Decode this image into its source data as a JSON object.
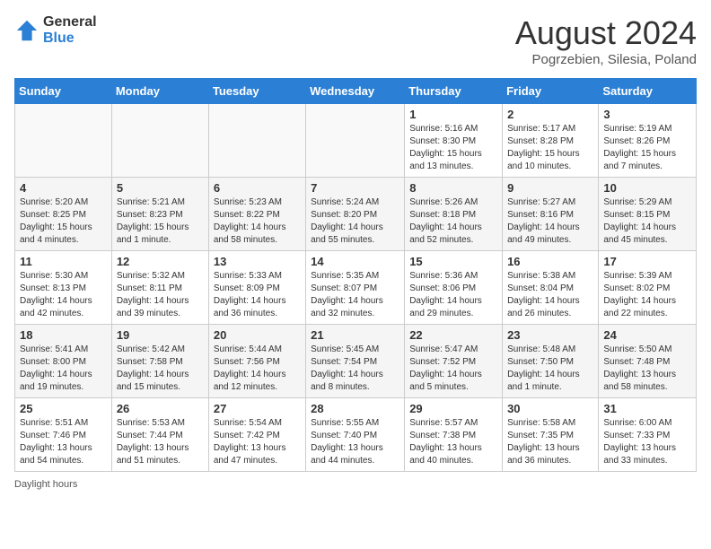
{
  "logo": {
    "general": "General",
    "blue": "Blue"
  },
  "title": "August 2024",
  "location": "Pogrzebien, Silesia, Poland",
  "days_header": [
    "Sunday",
    "Monday",
    "Tuesday",
    "Wednesday",
    "Thursday",
    "Friday",
    "Saturday"
  ],
  "weeks": [
    [
      {
        "num": "",
        "info": ""
      },
      {
        "num": "",
        "info": ""
      },
      {
        "num": "",
        "info": ""
      },
      {
        "num": "",
        "info": ""
      },
      {
        "num": "1",
        "info": "Sunrise: 5:16 AM\nSunset: 8:30 PM\nDaylight: 15 hours\nand 13 minutes."
      },
      {
        "num": "2",
        "info": "Sunrise: 5:17 AM\nSunset: 8:28 PM\nDaylight: 15 hours\nand 10 minutes."
      },
      {
        "num": "3",
        "info": "Sunrise: 5:19 AM\nSunset: 8:26 PM\nDaylight: 15 hours\nand 7 minutes."
      }
    ],
    [
      {
        "num": "4",
        "info": "Sunrise: 5:20 AM\nSunset: 8:25 PM\nDaylight: 15 hours\nand 4 minutes."
      },
      {
        "num": "5",
        "info": "Sunrise: 5:21 AM\nSunset: 8:23 PM\nDaylight: 15 hours\nand 1 minute."
      },
      {
        "num": "6",
        "info": "Sunrise: 5:23 AM\nSunset: 8:22 PM\nDaylight: 14 hours\nand 58 minutes."
      },
      {
        "num": "7",
        "info": "Sunrise: 5:24 AM\nSunset: 8:20 PM\nDaylight: 14 hours\nand 55 minutes."
      },
      {
        "num": "8",
        "info": "Sunrise: 5:26 AM\nSunset: 8:18 PM\nDaylight: 14 hours\nand 52 minutes."
      },
      {
        "num": "9",
        "info": "Sunrise: 5:27 AM\nSunset: 8:16 PM\nDaylight: 14 hours\nand 49 minutes."
      },
      {
        "num": "10",
        "info": "Sunrise: 5:29 AM\nSunset: 8:15 PM\nDaylight: 14 hours\nand 45 minutes."
      }
    ],
    [
      {
        "num": "11",
        "info": "Sunrise: 5:30 AM\nSunset: 8:13 PM\nDaylight: 14 hours\nand 42 minutes."
      },
      {
        "num": "12",
        "info": "Sunrise: 5:32 AM\nSunset: 8:11 PM\nDaylight: 14 hours\nand 39 minutes."
      },
      {
        "num": "13",
        "info": "Sunrise: 5:33 AM\nSunset: 8:09 PM\nDaylight: 14 hours\nand 36 minutes."
      },
      {
        "num": "14",
        "info": "Sunrise: 5:35 AM\nSunset: 8:07 PM\nDaylight: 14 hours\nand 32 minutes."
      },
      {
        "num": "15",
        "info": "Sunrise: 5:36 AM\nSunset: 8:06 PM\nDaylight: 14 hours\nand 29 minutes."
      },
      {
        "num": "16",
        "info": "Sunrise: 5:38 AM\nSunset: 8:04 PM\nDaylight: 14 hours\nand 26 minutes."
      },
      {
        "num": "17",
        "info": "Sunrise: 5:39 AM\nSunset: 8:02 PM\nDaylight: 14 hours\nand 22 minutes."
      }
    ],
    [
      {
        "num": "18",
        "info": "Sunrise: 5:41 AM\nSunset: 8:00 PM\nDaylight: 14 hours\nand 19 minutes."
      },
      {
        "num": "19",
        "info": "Sunrise: 5:42 AM\nSunset: 7:58 PM\nDaylight: 14 hours\nand 15 minutes."
      },
      {
        "num": "20",
        "info": "Sunrise: 5:44 AM\nSunset: 7:56 PM\nDaylight: 14 hours\nand 12 minutes."
      },
      {
        "num": "21",
        "info": "Sunrise: 5:45 AM\nSunset: 7:54 PM\nDaylight: 14 hours\nand 8 minutes."
      },
      {
        "num": "22",
        "info": "Sunrise: 5:47 AM\nSunset: 7:52 PM\nDaylight: 14 hours\nand 5 minutes."
      },
      {
        "num": "23",
        "info": "Sunrise: 5:48 AM\nSunset: 7:50 PM\nDaylight: 14 hours\nand 1 minute."
      },
      {
        "num": "24",
        "info": "Sunrise: 5:50 AM\nSunset: 7:48 PM\nDaylight: 13 hours\nand 58 minutes."
      }
    ],
    [
      {
        "num": "25",
        "info": "Sunrise: 5:51 AM\nSunset: 7:46 PM\nDaylight: 13 hours\nand 54 minutes."
      },
      {
        "num": "26",
        "info": "Sunrise: 5:53 AM\nSunset: 7:44 PM\nDaylight: 13 hours\nand 51 minutes."
      },
      {
        "num": "27",
        "info": "Sunrise: 5:54 AM\nSunset: 7:42 PM\nDaylight: 13 hours\nand 47 minutes."
      },
      {
        "num": "28",
        "info": "Sunrise: 5:55 AM\nSunset: 7:40 PM\nDaylight: 13 hours\nand 44 minutes."
      },
      {
        "num": "29",
        "info": "Sunrise: 5:57 AM\nSunset: 7:38 PM\nDaylight: 13 hours\nand 40 minutes."
      },
      {
        "num": "30",
        "info": "Sunrise: 5:58 AM\nSunset: 7:35 PM\nDaylight: 13 hours\nand 36 minutes."
      },
      {
        "num": "31",
        "info": "Sunrise: 6:00 AM\nSunset: 7:33 PM\nDaylight: 13 hours\nand 33 minutes."
      }
    ]
  ],
  "footer": "Daylight hours"
}
